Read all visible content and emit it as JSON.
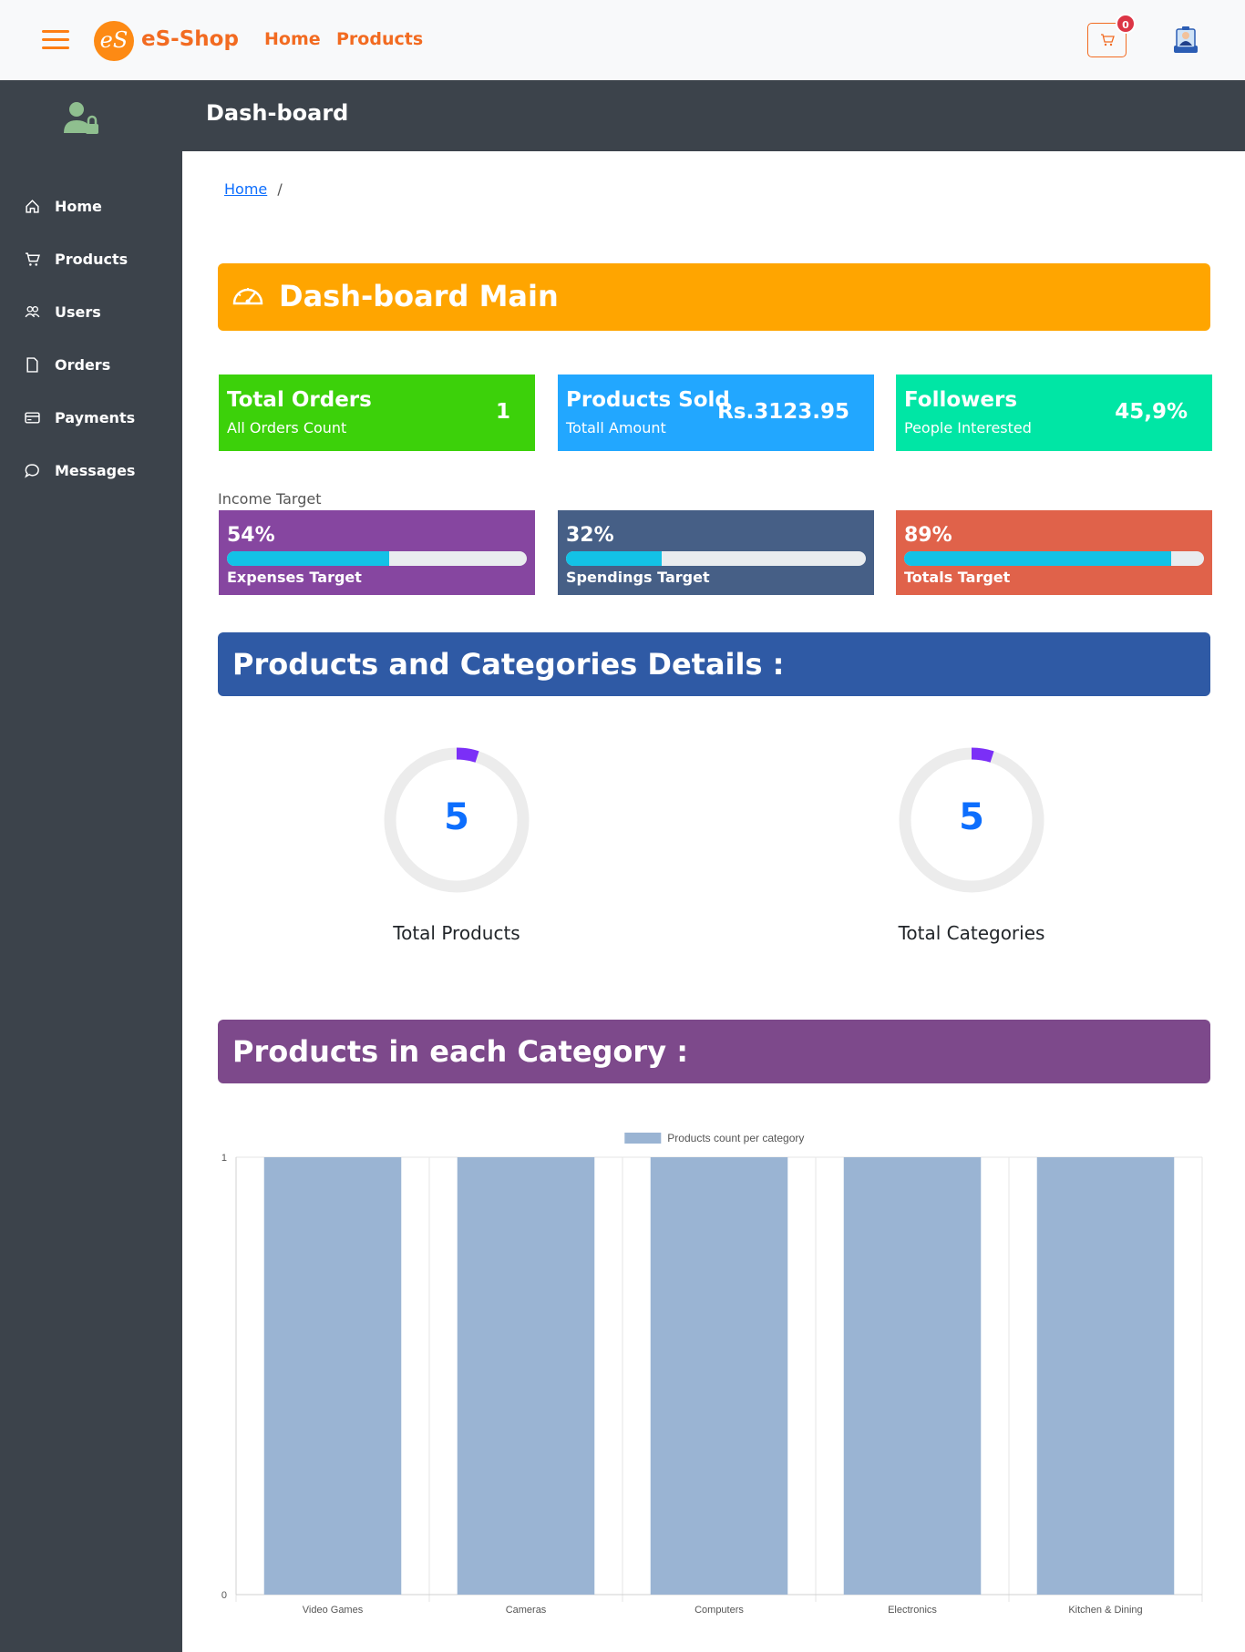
{
  "navbar": {
    "brand_initials": "eS",
    "brand": "eS-Shop",
    "links": [
      "Home",
      "Products"
    ],
    "cart_count": "0"
  },
  "sidebar": {
    "items": [
      {
        "label": "Home",
        "icon": "home-icon"
      },
      {
        "label": "Products",
        "icon": "cart-icon"
      },
      {
        "label": "Users",
        "icon": "users-icon"
      },
      {
        "label": "Orders",
        "icon": "file-icon"
      },
      {
        "label": "Payments",
        "icon": "credit-card-icon"
      },
      {
        "label": "Messages",
        "icon": "chat-icon"
      }
    ]
  },
  "header": {
    "title": "Dash-board"
  },
  "breadcrumb": {
    "home": "Home",
    "sep": "/"
  },
  "dashboard": {
    "title": "Dash-board Main",
    "color": "#ffa500"
  },
  "cards": [
    {
      "title": "Total Orders",
      "subtitle": "All Orders Count",
      "value": "1",
      "color": "#3cd10a"
    },
    {
      "title": "Products Sold",
      "subtitle": "Totall Amount",
      "value": "Rs.3123.95",
      "color": "#22a7ff"
    },
    {
      "title": "Followers",
      "subtitle": "People Interested",
      "value": "45,9%",
      "color": "#00e6a5"
    }
  ],
  "income": {
    "label": "Income Target",
    "targets": [
      {
        "percent": "54%",
        "progress": 0.54,
        "label": "Expenses Target",
        "color": "#8646a0"
      },
      {
        "percent": "32%",
        "progress": 0.32,
        "label": "Spendings Target",
        "color": "#465f86"
      },
      {
        "percent": "89%",
        "progress": 0.89,
        "label": "Totals Target",
        "color": "#e0624a"
      }
    ]
  },
  "details": {
    "title": "Products and Categories Details :",
    "color": "#2f5aa5",
    "donuts": [
      {
        "value": "5",
        "label": "Total Products",
        "fraction": 0.05
      },
      {
        "value": "5",
        "label": "Total Categories",
        "fraction": 0.05
      }
    ]
  },
  "category_section": {
    "title": "Products in each Category :",
    "color": "#7d498b"
  },
  "chart_data": {
    "type": "bar",
    "title": "",
    "categories": [
      "Video Games",
      "Cameras",
      "Computers",
      "Electronics",
      "Kitchen & Dining"
    ],
    "series": [
      {
        "name": "Products count per category",
        "values": [
          1,
          1,
          1,
          1,
          1
        ],
        "color": "#9ab4d3"
      }
    ],
    "ylim": [
      0,
      1
    ],
    "yticks": [
      "0",
      "1"
    ],
    "legend": "top-center",
    "grid": true
  }
}
